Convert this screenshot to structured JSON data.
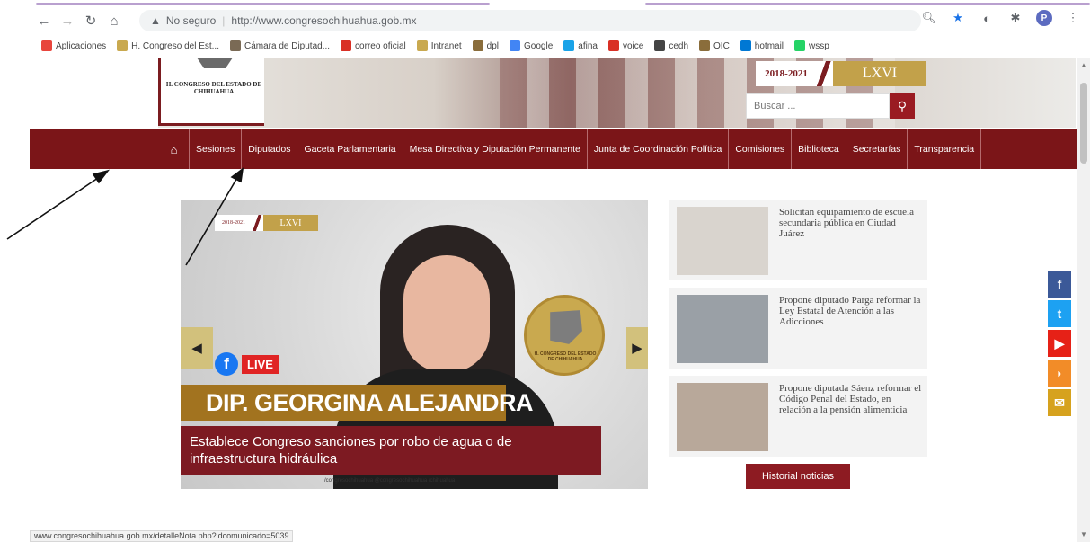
{
  "browser": {
    "url_security": "No seguro",
    "url": "http://www.congresochihuahua.gob.mx",
    "profile_initial": "P",
    "bookmarks": [
      {
        "label": "Aplicaciones",
        "color": "#e8453c"
      },
      {
        "label": "H. Congreso del Est...",
        "color": "#c9a94f"
      },
      {
        "label": "Cámara de Diputad...",
        "color": "#7a6a55"
      },
      {
        "label": "correo oficial",
        "color": "#d93025"
      },
      {
        "label": "Intranet",
        "color": "#c9a94f"
      },
      {
        "label": "dpl",
        "color": "#8a6d3b"
      },
      {
        "label": "Google",
        "color": "#4285f4"
      },
      {
        "label": "afina",
        "color": "#1aa3e8"
      },
      {
        "label": "voice",
        "color": "#d93025"
      },
      {
        "label": "cedh",
        "color": "#444444"
      },
      {
        "label": "OIC",
        "color": "#8a6d3b"
      },
      {
        "label": "hotmail",
        "color": "#0078d4"
      },
      {
        "label": "wssp",
        "color": "#25d366"
      }
    ],
    "status_url": "www.congresochihuahua.gob.mx/detalleNota.php?idcomunicado=5039"
  },
  "header": {
    "logo_text": "H. CONGRESO DEL ESTADO DE CHIHUAHUA",
    "legislature_years": "2018-2021",
    "legislature_number": "LXVI",
    "search_placeholder": "Buscar ..."
  },
  "nav": {
    "items": [
      "Sesiones",
      "Diputados",
      "Gaceta Parlamentaria",
      "Mesa Directiva y Diputación Permanente",
      "Junta de Coordinación Política",
      "Comisiones",
      "Biblioteca",
      "Secretarías",
      "Transparencia"
    ]
  },
  "slider": {
    "badge_years": "2018-2021",
    "badge_number": "LXVI",
    "live_label": "LIVE",
    "name_banner": "DIP. GEORGINA ALEJANDRA",
    "seal_text": "H. CONGRESO DEL ESTADO DE CHIHUAHUA",
    "caption": "Establece Congreso sanciones por robo de agua o de infraestructura hidráulica",
    "social_text": "/congresochihuahua  @congresochihuahua  /chihuahua"
  },
  "news": [
    {
      "title": "Solicitan equipamiento de escuela secundaria pública en Ciudad Juárez",
      "thumb_color": "#d9d4ce"
    },
    {
      "title": "Propone diputado Parga reformar la Ley Estatal de Atención a las Adicciones",
      "thumb_color": "#9aa0a6"
    },
    {
      "title": "Propone diputada Sáenz reformar el Código Penal del Estado, en relación a la pensión alimenticia",
      "thumb_color": "#b8a89a"
    }
  ],
  "historial_label": "Historial noticias",
  "social_side": [
    {
      "icon": "facebook-icon",
      "glyph": "f",
      "color": "#3b5998"
    },
    {
      "icon": "twitter-icon",
      "glyph": "t",
      "color": "#1da1f2"
    },
    {
      "icon": "youtube-icon",
      "glyph": "▶",
      "color": "#e62117"
    },
    {
      "icon": "rss-icon",
      "glyph": "◗",
      "color": "#f28c28"
    },
    {
      "icon": "email-icon",
      "glyph": "✉",
      "color": "#d6a21e"
    }
  ]
}
